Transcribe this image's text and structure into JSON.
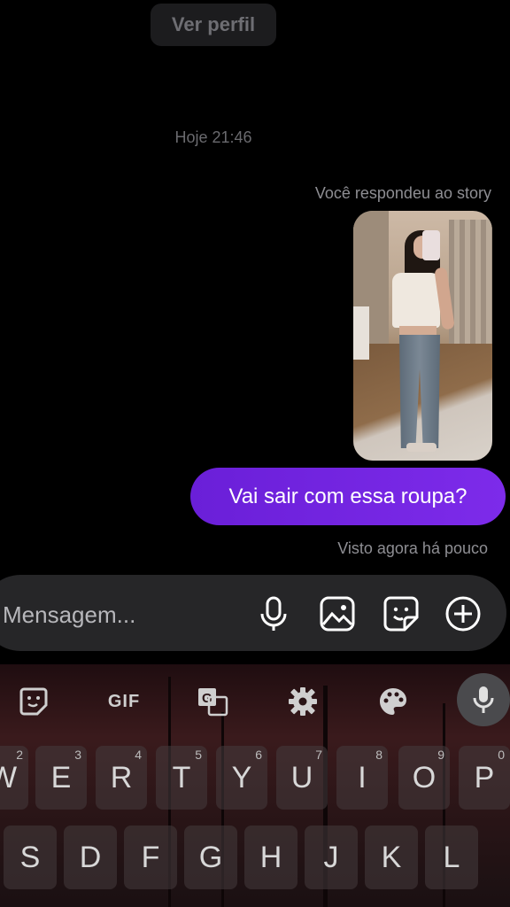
{
  "header": {
    "view_profile_label": "Ver perfil"
  },
  "chat": {
    "timestamp": "Hoje 21:46",
    "story_reply_label": "Você respondeu ao story",
    "sent_message": "Vai sair com essa roupa?",
    "seen_status": "Visto agora há pouco"
  },
  "composer": {
    "placeholder": "Mensagem...",
    "icons": [
      "microphone-icon",
      "image-icon",
      "sticker-icon",
      "plus-icon"
    ]
  },
  "keyboard": {
    "toolbar": [
      "sticker-icon",
      "GIF",
      "translate-icon",
      "settings-icon",
      "palette-icon",
      "microphone-icon"
    ],
    "gif_label": "GIF",
    "row1": [
      {
        "key": "W",
        "hint": "2"
      },
      {
        "key": "E",
        "hint": "3"
      },
      {
        "key": "R",
        "hint": "4"
      },
      {
        "key": "T",
        "hint": "5"
      },
      {
        "key": "Y",
        "hint": "6"
      },
      {
        "key": "U",
        "hint": "7"
      },
      {
        "key": "I",
        "hint": "8"
      },
      {
        "key": "O",
        "hint": "9"
      },
      {
        "key": "P",
        "hint": "0"
      }
    ],
    "row2": [
      {
        "key": "S"
      },
      {
        "key": "D"
      },
      {
        "key": "F"
      },
      {
        "key": "G"
      },
      {
        "key": "H"
      },
      {
        "key": "J"
      },
      {
        "key": "K"
      },
      {
        "key": "L"
      }
    ]
  },
  "colors": {
    "sent_bubble": "#7a2be8",
    "composer_bg": "#262628",
    "background": "#000000"
  }
}
